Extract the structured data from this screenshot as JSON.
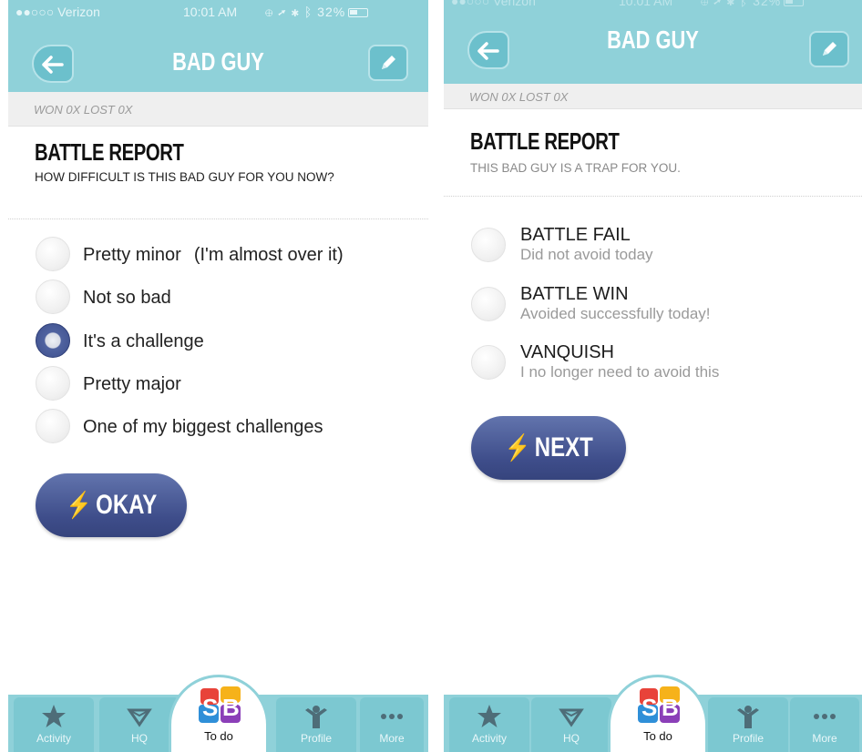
{
  "status_bar": {
    "carrier": "●●○○○ Verizon",
    "time": "10:01 AM",
    "battery": "32%"
  },
  "header": {
    "title": "BAD GUY",
    "back_icon": "back-arrow-icon",
    "edit_icon": "pencil-icon"
  },
  "record": "WON 0X LOST 0X",
  "left_screen": {
    "section_title": "BATTLE REPORT",
    "question": "HOW DIFFICULT IS THIS BAD GUY FOR YOU NOW?",
    "options": [
      {
        "label": "Pretty minor",
        "note": "(I'm almost over it)",
        "selected": false
      },
      {
        "label": "Not so bad",
        "note": "",
        "selected": false
      },
      {
        "label": "It's a challenge",
        "note": "",
        "selected": true
      },
      {
        "label": "Pretty major",
        "note": "",
        "selected": false
      },
      {
        "label": "One of my biggest challenges",
        "note": "",
        "selected": false
      }
    ],
    "action_label": "OKAY",
    "action_icon": "lightning-icon"
  },
  "right_screen": {
    "section_title": "BATTLE REPORT",
    "subtitle": "THIS BAD GUY IS A TRAP FOR YOU.",
    "options": [
      {
        "title": "BATTLE FAIL",
        "desc": "Did not avoid today",
        "selected": false
      },
      {
        "title": "BATTLE WIN",
        "desc": "Avoided successfully today!",
        "selected": false
      },
      {
        "title": "VANQUISH",
        "desc": "I no longer need to avoid this",
        "selected": false
      }
    ],
    "action_label": "NEXT",
    "action_icon": "lightning-icon"
  },
  "tabbar": {
    "tabs": [
      {
        "label": "Activity",
        "icon": "activity-star-icon"
      },
      {
        "label": "HQ",
        "icon": "hq-diamond-icon"
      },
      {
        "label": "To do",
        "icon": "sb-logo-icon",
        "active": true
      },
      {
        "label": "Profile",
        "icon": "profile-person-icon"
      },
      {
        "label": "More",
        "icon": "more-dots-icon"
      }
    ]
  },
  "colors": {
    "header": "#8fd1d9",
    "tab_bg": "#7cc8d1",
    "button": "#3e4d8a",
    "record_bar": "#efefef"
  }
}
